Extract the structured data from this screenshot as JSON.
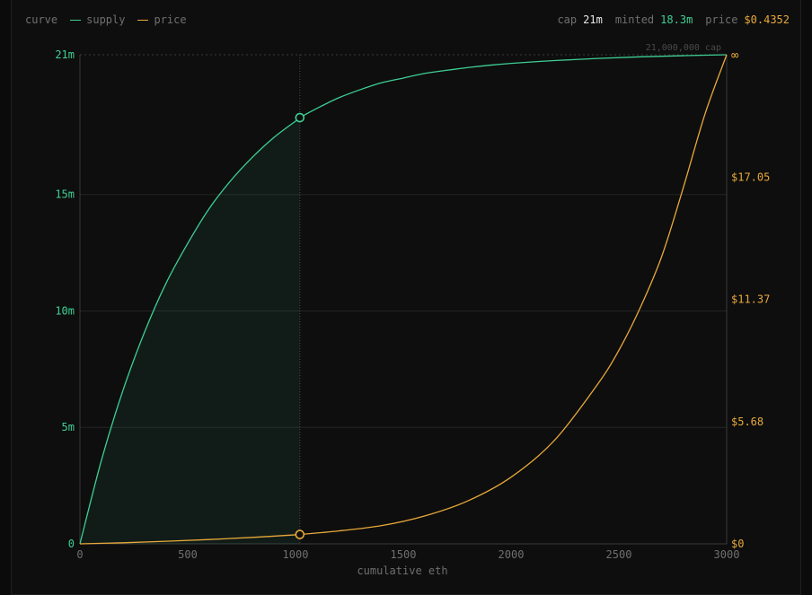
{
  "header": {
    "curve_label": "curve",
    "legend": [
      {
        "name": "supply",
        "color": "#3ecf95"
      },
      {
        "name": "price",
        "color": "#e8a93a"
      }
    ],
    "stats": [
      {
        "label": "cap",
        "value": "21m",
        "kind": "cap"
      },
      {
        "label": "minted",
        "value": "18.3m",
        "kind": "minted"
      },
      {
        "label": "price",
        "value": "$0.4352",
        "kind": "price"
      }
    ]
  },
  "colors": {
    "supply": "#3ecf95",
    "price": "#e8a93a",
    "grid": "#242424",
    "axis": "#3a3a3a",
    "muted": "#6f6f6f"
  },
  "chart_data": {
    "type": "line",
    "xlabel": "cumulative eth",
    "xlim": [
      0,
      3000
    ],
    "x_ticks": [
      0,
      500,
      1000,
      1500,
      2000,
      2500,
      3000
    ],
    "y_left": {
      "lim": [
        0,
        21000000
      ],
      "ticks": [
        {
          "value": 0,
          "label": "0"
        },
        {
          "value": 5000000,
          "label": "5m"
        },
        {
          "value": 10000000,
          "label": "10m"
        },
        {
          "value": 15000000,
          "label": "15m"
        },
        {
          "value": 21000000,
          "label": "21m"
        }
      ]
    },
    "y_right": {
      "ticks": [
        {
          "label": "$0",
          "fraction": 0
        },
        {
          "label": "$5.68",
          "fraction": 0.25
        },
        {
          "label": "$11.37",
          "fraction": 0.5
        },
        {
          "label": "$17.05",
          "fraction": 0.75
        },
        {
          "label": "∞",
          "fraction": 1
        }
      ]
    },
    "cap_line": {
      "value": 21000000,
      "label": "21,000,000 cap"
    },
    "marker": {
      "x": 1020,
      "supply": 18300000,
      "price": 0.4352
    },
    "series": [
      {
        "name": "supply",
        "x": [
          0,
          100,
          200,
          300,
          400,
          500,
          600,
          700,
          800,
          900,
          1000,
          1020,
          1100,
          1200,
          1300,
          1400,
          1500,
          1600,
          1700,
          1800,
          1900,
          2000,
          2200,
          2400,
          2600,
          2800,
          3000
        ],
        "values": [
          0,
          3600000,
          6600000,
          9100000,
          11200000,
          12900000,
          14400000,
          15600000,
          16600000,
          17450000,
          18150000,
          18300000,
          18700000,
          19150000,
          19500000,
          19800000,
          20000000,
          20200000,
          20330000,
          20450000,
          20550000,
          20630000,
          20750000,
          20840000,
          20910000,
          20960000,
          21000000
        ]
      },
      {
        "name": "price",
        "x": [
          0,
          200,
          400,
          600,
          800,
          1000,
          1020,
          1200,
          1400,
          1600,
          1800,
          2000,
          2200,
          2400,
          2500,
          2600,
          2700,
          2800,
          2900,
          3000
        ],
        "values": [
          0,
          0.05,
          0.12,
          0.2,
          0.3,
          0.42,
          0.4352,
          0.6,
          0.85,
          1.3,
          2.0,
          3.1,
          4.8,
          7.4,
          9.0,
          11.0,
          13.4,
          16.6,
          20.0,
          22.74
        ]
      }
    ]
  }
}
